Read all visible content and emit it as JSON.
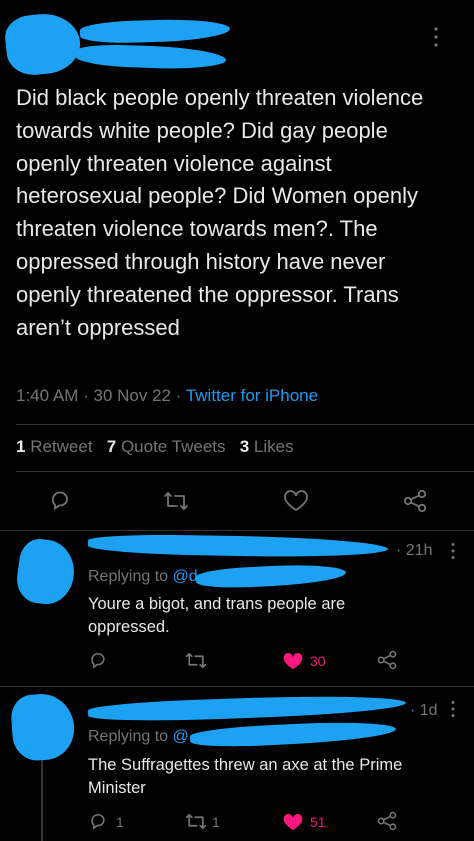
{
  "tweet": {
    "text": "Did black people openly threaten violence towards white people? Did gay people openly threaten violence against heterosexual people? Did Women openly threaten violence towards men?. The oppressed through history have never openly threatened the oppressor. Trans aren’t oppressed",
    "time": "1:40 AM",
    "date": "30 Nov 22",
    "source": "Twitter for iPhone",
    "retweets_count": "1",
    "retweets_label": "Retweet",
    "quotes_count": "7",
    "quotes_label": "Quote Tweets",
    "likes_count": "3",
    "likes_label": "Likes",
    "more_icon": "more-vertical-icon"
  },
  "replies": [
    {
      "time": "21h",
      "replying_to_label": "Replying to",
      "replying_to_handle": "@d",
      "text": "Youre a bigot, and trans people are oppressed.",
      "reply_count": "",
      "retweet_count": "",
      "like_count": "30",
      "liked": true
    },
    {
      "time": "1d",
      "replying_to_label": "Replying to",
      "replying_to_handle": "@",
      "text": "The Suffragettes threw an axe at the Prime Minister",
      "reply_count": "1",
      "retweet_count": "1",
      "like_count": "51",
      "liked": true
    }
  ],
  "colors": {
    "background": "#000000",
    "text": "#e7e9ea",
    "muted": "#71767b",
    "link": "#1d9bf0",
    "like": "#f91880",
    "redaction": "#1da1f2"
  }
}
